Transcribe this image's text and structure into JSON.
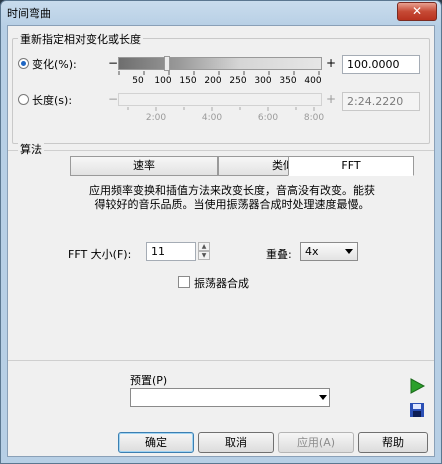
{
  "window": {
    "title": "时间弯曲",
    "close_glyph": "✕"
  },
  "range_group": {
    "title": "重新指定相对变化或长度",
    "change_label": "变化(%):",
    "change_value": "100.0000",
    "change_ticks": [
      "50",
      "100",
      "150",
      "200",
      "250",
      "300",
      "350",
      "400"
    ],
    "length_label": "长度(s):",
    "length_value": "2:24.2220",
    "length_ticks": [
      "2:00",
      "4:00",
      "6:00",
      "8:00"
    ],
    "minus": "−",
    "plus": "+"
  },
  "algorithm": {
    "title": "算法",
    "tabs": [
      {
        "label": "速率"
      },
      {
        "label": "类似"
      },
      {
        "label": "FFT"
      }
    ],
    "description_line1": "应用频率变换和插值方法来改变长度，音高没有改变。能获",
    "description_line2": "得较好的音乐品质。当使用振荡器合成时处理速度最慢。",
    "fft_size_label": "FFT 大小(F):",
    "fft_size_value": "11",
    "overlap_label": "重叠:",
    "overlap_value": "4x",
    "oscillator_label": "振荡器合成"
  },
  "preset": {
    "label": "预置(P)",
    "value": "",
    "play_icon": "play-icon",
    "save_icon": "save-icon"
  },
  "buttons": {
    "ok": "确定",
    "cancel": "取消",
    "apply": "应用(A)",
    "help": "帮助"
  },
  "colors": {
    "play": "#2ca02c",
    "save": "#2a4fb5",
    "radio_dot": "#1f66c3"
  }
}
